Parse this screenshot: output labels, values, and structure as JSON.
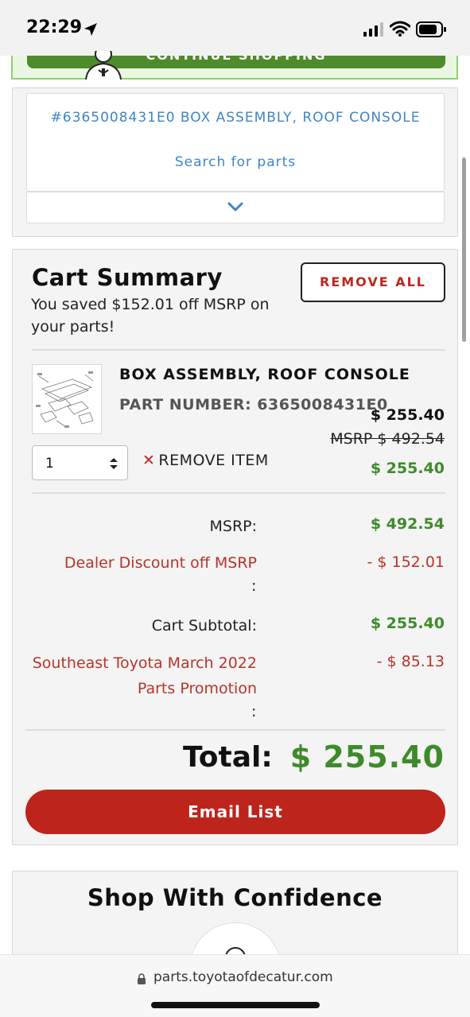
{
  "status_bar": {
    "time": "22:29"
  },
  "continue_shopping": {
    "label": "CONTINUE SHOPPING"
  },
  "part_search": {
    "part_heading": "#6365008431E0 BOX ASSEMBLY, ROOF CONSOLE",
    "search_link": "Search for parts"
  },
  "cart_summary": {
    "title": "Cart Summary",
    "saved_text": "You saved $152.01 off MSRP on your parts!",
    "remove_all_label": "REMOVE ALL",
    "item": {
      "name": "BOX ASSEMBLY, ROOF CONSOLE",
      "part_number": "PART NUMBER: 6365008431E0",
      "price": "$ 255.40",
      "msrp": "MSRP $ 492.54",
      "final_price": "$ 255.40",
      "quantity": "1",
      "remove_label": "REMOVE ITEM"
    },
    "summary": {
      "msrp_label": "MSRP:",
      "msrp_value": "$ 492.54",
      "discount_label": "Dealer Discount off MSRP",
      "discount_colon": ":",
      "discount_value": "- $ 152.01",
      "subtotal_label": "Cart Subtotal:",
      "subtotal_value": "$ 255.40",
      "promo_label": "Southeast Toyota March 2022 Parts Promotion",
      "promo_colon": ":",
      "promo_value": "- $ 85.13"
    },
    "total_label": "Total:",
    "total_value": "$ 255.40",
    "email_button": "Email List"
  },
  "confidence": {
    "title": "Shop With Confidence"
  },
  "url_bar": {
    "url": "parts.toyotaofdecatur.com"
  },
  "colors": {
    "accent_red": "#bd241c",
    "price_green": "#3e8b2a",
    "link_blue": "#3f85c4",
    "continue_green": "#4e8b2a"
  }
}
